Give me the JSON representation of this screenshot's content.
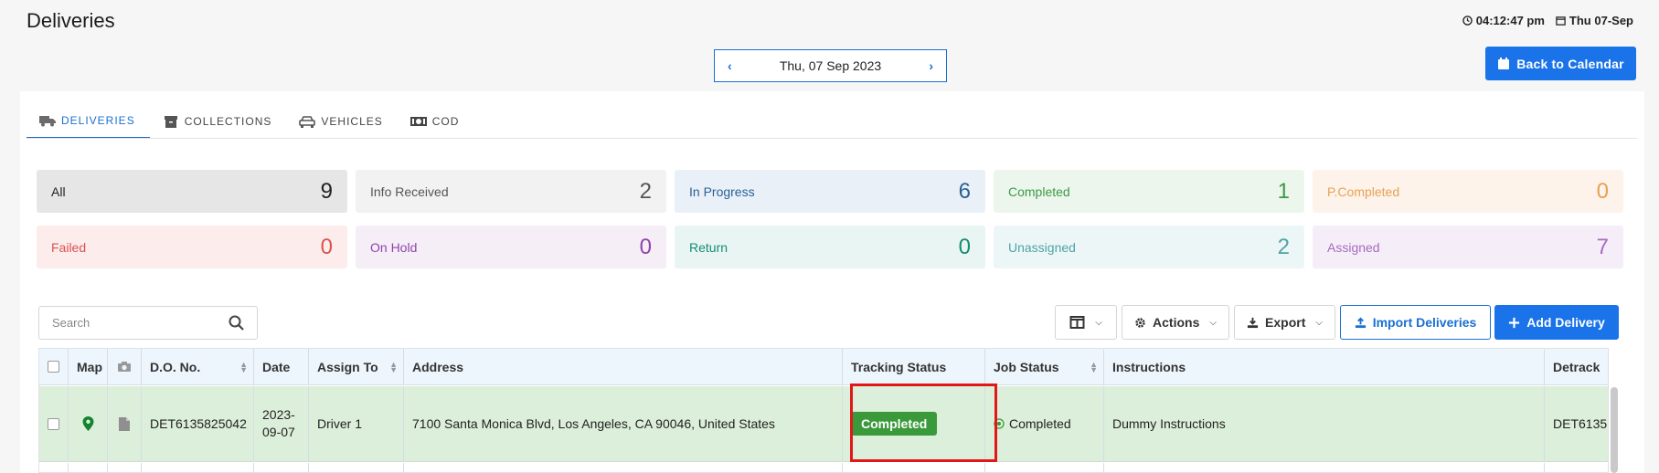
{
  "header": {
    "title": "Deliveries",
    "time": "04:12:47 pm",
    "date": "Thu 07-Sep",
    "back_label": "Back to Calendar"
  },
  "date_nav": {
    "label": "Thu, 07 Sep 2023",
    "prev": "‹",
    "next": "›"
  },
  "tabs": [
    {
      "label": "DELIVERIES",
      "icon": "truck-icon",
      "active": true
    },
    {
      "label": "COLLECTIONS",
      "icon": "box-icon",
      "active": false
    },
    {
      "label": "VEHICLES",
      "icon": "car-icon",
      "active": false
    },
    {
      "label": "COD",
      "icon": "cash-icon",
      "active": false
    }
  ],
  "stats": [
    {
      "label": "All",
      "count": "9",
      "bg": "#e6e6e6",
      "color": "#222222"
    },
    {
      "label": "Info Received",
      "count": "2",
      "bg": "#f2f2f2",
      "color": "#555555"
    },
    {
      "label": "In Progress",
      "count": "6",
      "bg": "#eaf0f8",
      "color": "#2a6096"
    },
    {
      "label": "Completed",
      "count": "1",
      "bg": "#edf6ec",
      "color": "#3c9a45"
    },
    {
      "label": "P.Completed",
      "count": "0",
      "bg": "#fdf3ea",
      "color": "#e8a154"
    },
    {
      "label": "Failed",
      "count": "0",
      "bg": "#fdecec",
      "color": "#d9534f"
    },
    {
      "label": "On Hold",
      "count": "0",
      "bg": "#f5eef7",
      "color": "#8e44ad"
    },
    {
      "label": "Return",
      "count": "0",
      "bg": "#e9f5f2",
      "color": "#138d75"
    },
    {
      "label": "Unassigned",
      "count": "2",
      "bg": "#edf6f6",
      "color": "#4fa3a7"
    },
    {
      "label": "Assigned",
      "count": "7",
      "bg": "#f5eef8",
      "color": "#a66bbf"
    }
  ],
  "search": {
    "placeholder": "Search"
  },
  "toolbar": {
    "actions": "Actions",
    "export": "Export",
    "import": "Import Deliveries",
    "add": "Add Delivery"
  },
  "table": {
    "headers": [
      "Map",
      "D.O. No.",
      "Date",
      "Assign To",
      "Address",
      "Tracking Status",
      "Job Status",
      "Instructions",
      "Detrack"
    ],
    "row": {
      "do_no": "DET6135825042",
      "date": "2023-09-07",
      "assign_to": "Driver 1",
      "address": "7100 Santa Monica Blvd, Los Angeles, CA 90046, United States",
      "tracking_status": "Completed",
      "job_status": "Completed",
      "instructions": "Dummy Instructions",
      "detrack": "DET6135"
    }
  }
}
